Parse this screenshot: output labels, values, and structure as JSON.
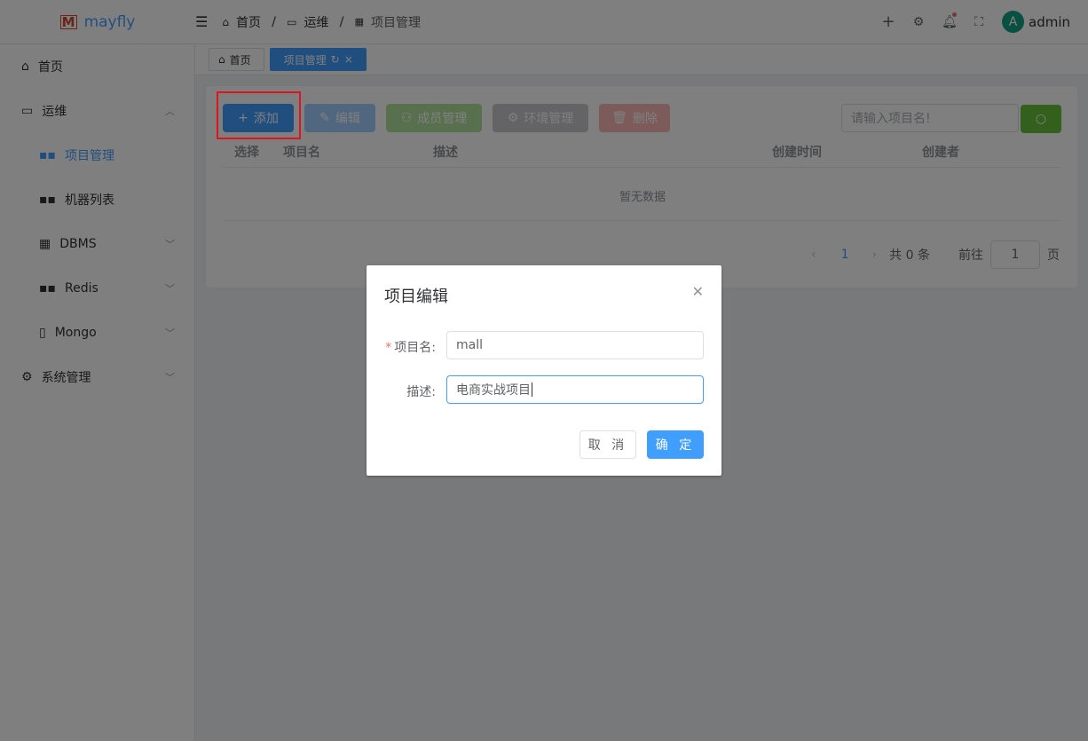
{
  "header": {
    "logo": "mayfly",
    "logo_mark": "M",
    "breadcrumb": [
      "首页",
      "运维",
      "项目管理"
    ],
    "user": "admin",
    "avatar_letter": "A"
  },
  "sidebar": {
    "items": [
      {
        "label": "首页"
      },
      {
        "label": "运维"
      },
      {
        "label": "项目管理"
      },
      {
        "label": "机器列表"
      },
      {
        "label": "DBMS"
      },
      {
        "label": "Redis"
      },
      {
        "label": "Mongo"
      },
      {
        "label": "系统管理"
      }
    ]
  },
  "tags": [
    {
      "label": "首页"
    },
    {
      "label": "项目管理"
    }
  ],
  "toolbar": {
    "add": "添加",
    "edit": "编辑",
    "members": "成员管理",
    "env": "环境管理",
    "delete": "删除",
    "search_placeholder": "请输入项目名!"
  },
  "table": {
    "columns": [
      "选择",
      "项目名",
      "描述",
      "创建时间",
      "创建者"
    ],
    "empty": "暂无数据"
  },
  "pagination": {
    "page": "1",
    "total": "共 0 条",
    "goto": "前往",
    "goto_value": "1",
    "page_unit": "页"
  },
  "dialog": {
    "title": "项目编辑",
    "name_label": "项目名:",
    "name_value": "mall",
    "desc_label": "描述:",
    "desc_value": "电商实战项目",
    "cancel": "取 消",
    "confirm": "确 定"
  },
  "colors": {
    "primary": "#409eff",
    "success": "#67c23a",
    "danger": "#f56c6c"
  }
}
